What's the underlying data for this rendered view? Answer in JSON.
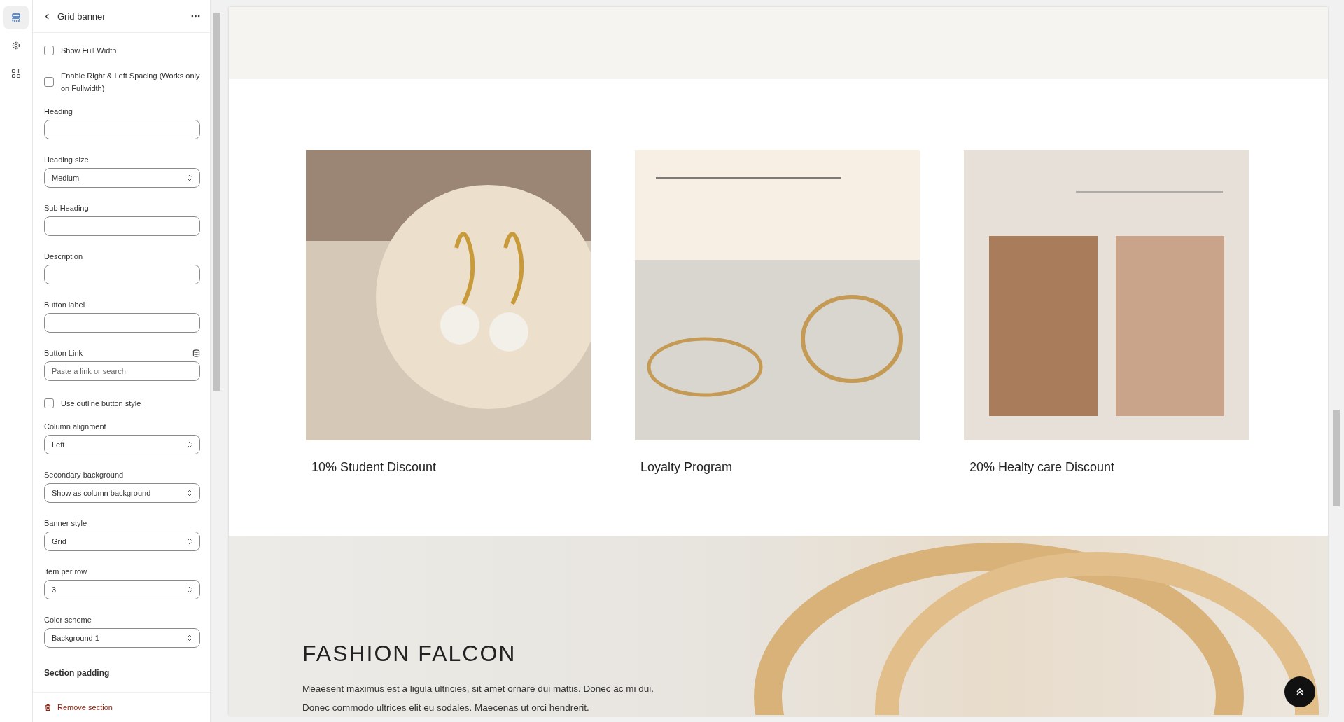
{
  "rail": [
    {
      "kind": "sections",
      "selected": true
    },
    {
      "kind": "settings",
      "selected": false
    },
    {
      "kind": "apps",
      "selected": false
    }
  ],
  "panel": {
    "title": "Grid banner",
    "fields": [
      {
        "kind": "checkbox",
        "label": "Show Full Width",
        "checked": false
      },
      {
        "kind": "checkbox",
        "label": "Enable Right & Left Spacing (Works only on Fullwidth)",
        "checked": false
      },
      {
        "kind": "text",
        "label": "Heading"
      },
      {
        "kind": "select",
        "label": "Heading size",
        "value": "Medium"
      },
      {
        "kind": "text",
        "label": "Sub Heading"
      },
      {
        "kind": "text",
        "label": "Description"
      },
      {
        "kind": "text",
        "label": "Button label"
      },
      {
        "kind": "link",
        "label": "Button Link",
        "placeholder": "Paste a link or search"
      },
      {
        "kind": "checkbox",
        "label": "Use outline button style",
        "checked": false
      },
      {
        "kind": "select",
        "label": "Column alignment",
        "value": "Left"
      },
      {
        "kind": "select",
        "label": "Secondary background",
        "value": "Show as column background"
      },
      {
        "kind": "select",
        "label": "Banner style",
        "value": "Grid"
      },
      {
        "kind": "select",
        "label": "Item per row",
        "value": "3"
      },
      {
        "kind": "select",
        "label": "Color scheme",
        "value": "Background 1"
      },
      {
        "kind": "heading",
        "label": "Section padding"
      }
    ],
    "remove_label": "Remove section"
  },
  "banners": [
    {
      "kind": "earrings",
      "caption": "10% Student Discount"
    },
    {
      "kind": "bracelets",
      "caption": "Loyalty Program"
    },
    {
      "kind": "chains",
      "caption": "20% Healty care Discount"
    }
  ],
  "hero": {
    "title": "FASHION FALCON",
    "text": "Meaesent maximus est a ligula ultricies, sit amet ornare dui mattis. Donec ac mi dui.\nDonec commodo ultrices elit eu sodales. Maecenas ut orci hendrerit."
  }
}
